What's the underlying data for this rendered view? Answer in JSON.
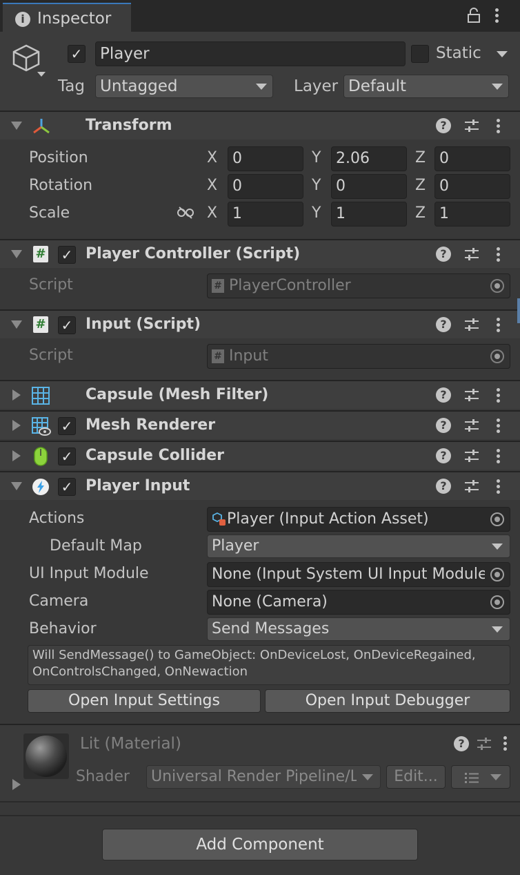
{
  "tab": {
    "label": "Inspector",
    "icon": "info-icon"
  },
  "header": {
    "name": "Player",
    "active": true,
    "static_label": "Static",
    "tag_label": "Tag",
    "tag_value": "Untagged",
    "layer_label": "Layer",
    "layer_value": "Default"
  },
  "transform": {
    "title": "Transform",
    "rows": [
      {
        "label": "Position",
        "x": "0",
        "y": "2.06",
        "z": "0"
      },
      {
        "label": "Rotation",
        "x": "0",
        "y": "0",
        "z": "0"
      },
      {
        "label": "Scale",
        "x": "1",
        "y": "1",
        "z": "1"
      }
    ],
    "axis": {
      "x": "X",
      "y": "Y",
      "z": "Z"
    }
  },
  "player_controller": {
    "title": "Player Controller (Script)",
    "script_label": "Script",
    "script_value": "PlayerController"
  },
  "input_script": {
    "title": "Input (Script)",
    "script_label": "Script",
    "script_value": "Input"
  },
  "mesh_filter": {
    "title": "Capsule (Mesh Filter)"
  },
  "mesh_renderer": {
    "title": "Mesh Renderer"
  },
  "capsule_collider": {
    "title": "Capsule Collider"
  },
  "player_input": {
    "title": "Player Input",
    "actions_label": "Actions",
    "actions_value": "Player (Input Action Asset)",
    "default_map_label": "Default Map",
    "default_map_value": "Player",
    "ui_module_label": "UI Input Module",
    "ui_module_value": "None (Input System UI Input Module)",
    "camera_label": "Camera",
    "camera_value": "None (Camera)",
    "behavior_label": "Behavior",
    "behavior_value": "Send Messages",
    "help_line1": "Will SendMessage() to GameObject: OnDeviceLost, OnDeviceRegained,",
    "help_line2": "OnControlsChanged, OnNewaction",
    "open_settings": "Open Input Settings",
    "open_debugger": "Open Input Debugger"
  },
  "material": {
    "title": "Lit (Material)",
    "shader_label": "Shader",
    "shader_value": "Universal Render Pipeline/Lit",
    "edit_label": "Edit..."
  },
  "add_component": "Add Component"
}
